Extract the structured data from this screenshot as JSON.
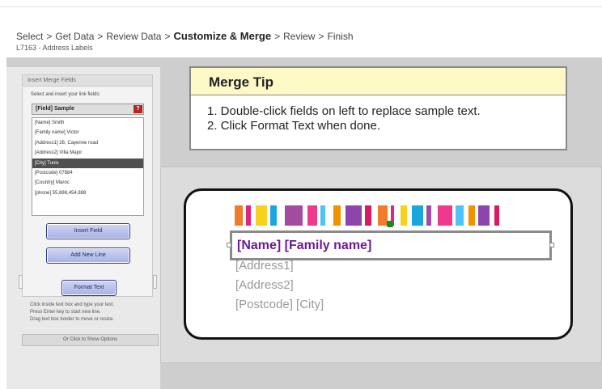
{
  "breadcrumb": {
    "steps": [
      "Select",
      "Get Data",
      "Review Data",
      "Customize & Merge",
      "Review",
      "Finish"
    ],
    "separator": ">",
    "active_index": 3
  },
  "subtitle": "L7163 - Address Labels",
  "merge_fields": {
    "panel_title": "Insert Merge Fields",
    "instruction": "Select and insert your link fields:",
    "list_header": "[Field] Sample",
    "help_label": "?",
    "items": [
      "[Name] Smith",
      "[Family name] Victor",
      "[Address1] 26, Cayenne road",
      "[Address2] Villa Major",
      "[City] Tunis",
      "[Postcode] 07884",
      "[Country] Maroc",
      "[phone] 55,888,454,888"
    ],
    "selected_index": 4,
    "insert_button": "Insert Field",
    "new_line_button": "Add New Line",
    "format_button": "Format Text"
  },
  "instructions": [
    "Click inside text box and type your text.",
    "Press Enter key to start new line.",
    "Drag text box border to move or resize."
  ],
  "options_link": "Or Click to Show Options",
  "merge_tip": {
    "title": "Merge Tip",
    "line1": "1. Double-click fields on left to replace sample text.",
    "line2": "2. Click Format Text when done."
  },
  "label": {
    "name_line": "[Name] [Family name]",
    "address1": "[Address1]",
    "address2": "[Address2]",
    "postcode_city": "[Postcode] [City]",
    "name_color": "#6a1b9a",
    "stripe_colors": [
      "#f07c2a",
      "#e4237e",
      "#f7d21c",
      "#1aa7e0",
      "#a24ba0",
      "#ee3a8c",
      "#4fc3f7",
      "#f39200",
      "#8e44ad",
      "#d81b60"
    ]
  },
  "colors": {
    "tip_header": "#fff9c8",
    "button_border": "#2d3a8c",
    "workspace": "#cecece"
  }
}
